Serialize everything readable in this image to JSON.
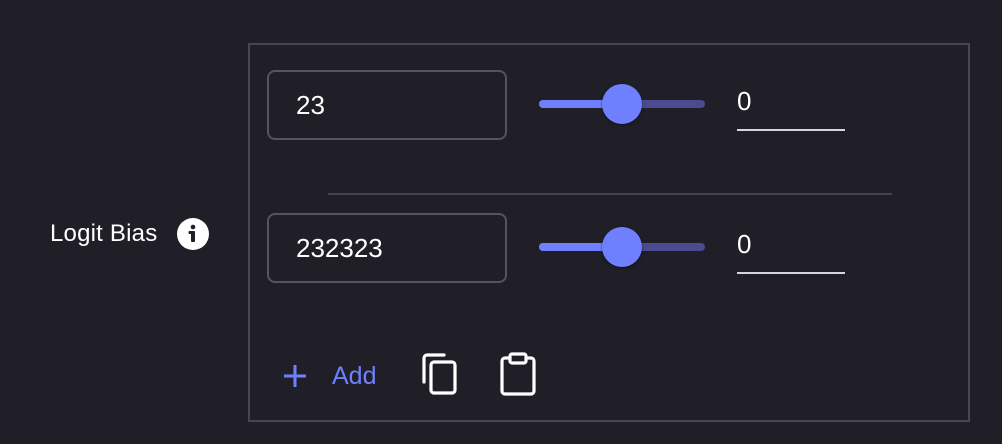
{
  "field": {
    "label": "Logit Bias"
  },
  "rows": [
    {
      "token": "23",
      "bias": "0",
      "slider_fraction": 0.5
    },
    {
      "token": "232323",
      "bias": "0",
      "slider_fraction": 0.5
    }
  ],
  "actions": {
    "add_label": "Add"
  },
  "icons": {
    "info": "info-icon",
    "add": "plus-icon",
    "copy": "copy-icon",
    "paste": "clipboard-icon"
  },
  "colors": {
    "background": "#201f27",
    "accent": "#6f80ff",
    "track": "#4a4c8f",
    "border": "#48474f"
  }
}
